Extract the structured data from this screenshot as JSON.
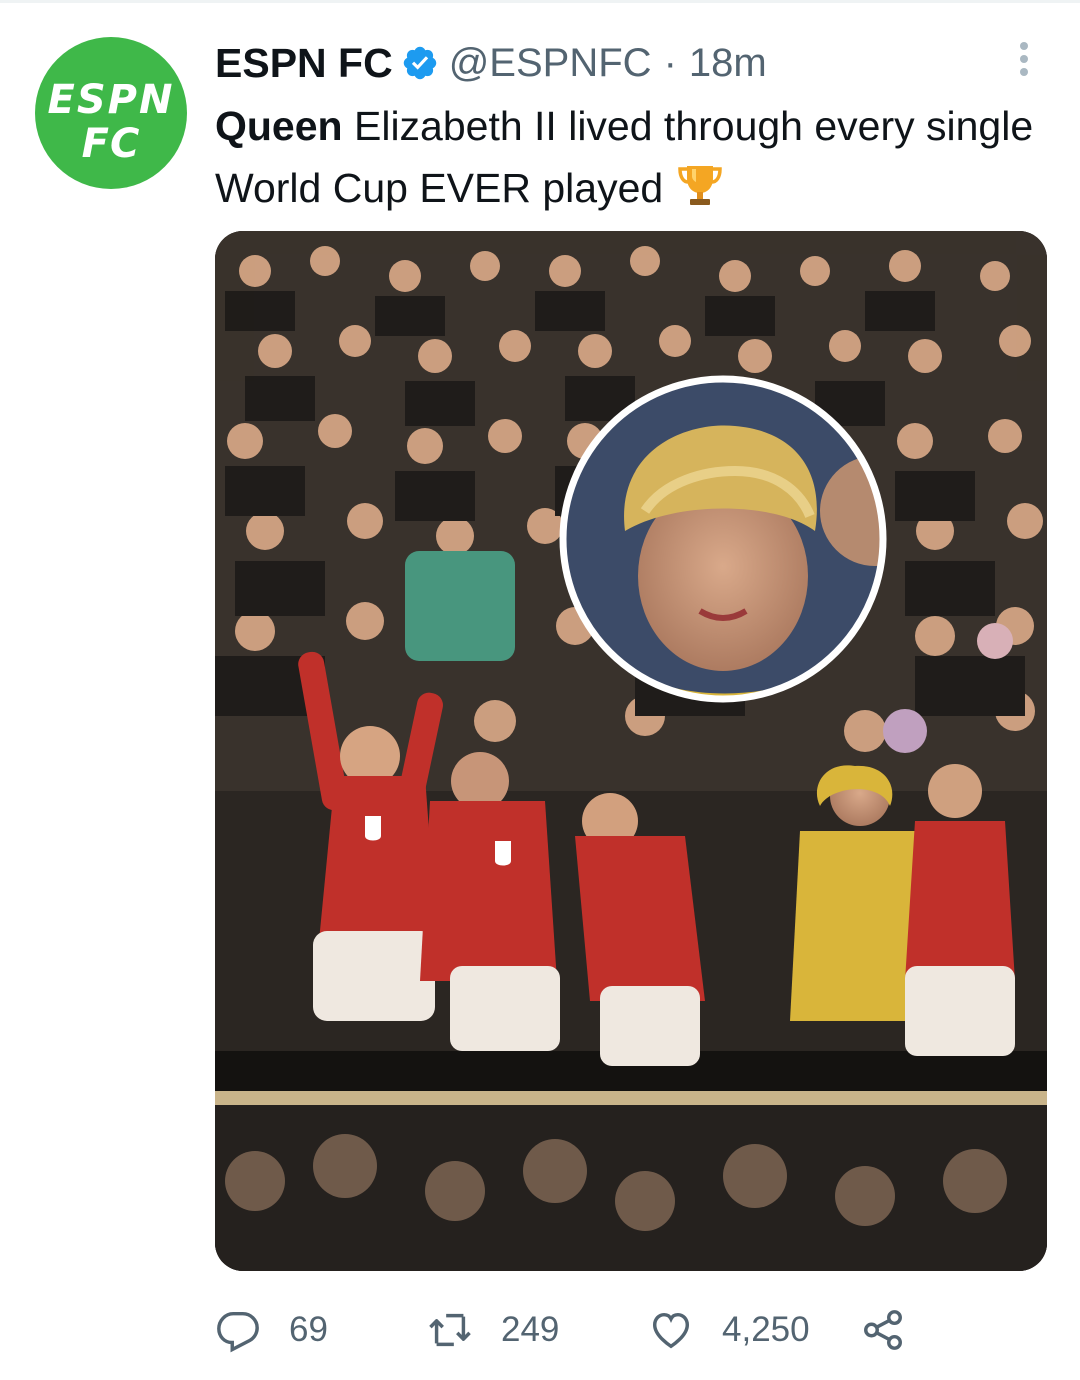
{
  "tweet": {
    "author": {
      "name": "ESPN FC",
      "handle": "@ESPNFC",
      "verified": true,
      "avatar_text_top": "ESPN",
      "avatar_text_bottom": "FC",
      "avatar_color": "#3fb849"
    },
    "separator": "·",
    "time": "18m",
    "text_bold": "Queen",
    "text_rest": " Elizabeth II lived through every single World Cup EVER played",
    "emoji": "trophy-icon",
    "stats": {
      "replies": "69",
      "retweets": "249",
      "likes": "4,250"
    }
  },
  "colors": {
    "verified": "#1d9bf0",
    "secondary_text": "#536471",
    "england_shirt": "#c0302a",
    "queen_coat": "#d9b53a"
  }
}
